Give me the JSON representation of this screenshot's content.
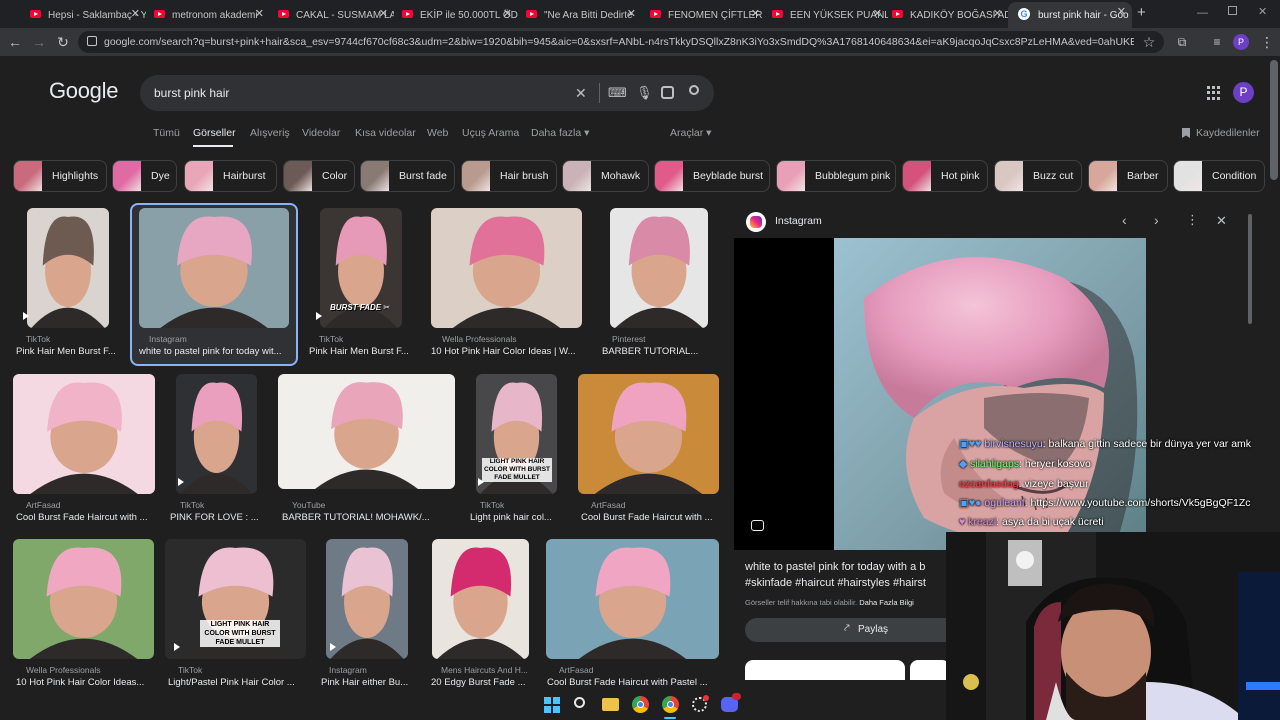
{
  "tabs": [
    {
      "label": "Hepsi - Saklambaç - Y"
    },
    {
      "label": "metronom akademi"
    },
    {
      "label": "CAKAL - SUSMAM LA"
    },
    {
      "label": "EKİP ile 50.000TL ÖD"
    },
    {
      "label": "\"Ne Ara Bitti Dedirte"
    },
    {
      "label": "FENOMEN ÇİFTLER S"
    },
    {
      "label": "EEN YÜKSEK PUANLI"
    },
    {
      "label": "KADIKÖY BOĞASI AD"
    },
    {
      "label": "burst pink hair - Goo"
    }
  ],
  "new_tab": "+",
  "address": {
    "url": "google.com/search?q=burst+pink+hair&sca_esv=9744cf670cf68c3&udm=2&biw=1920&bih=945&aic=0&sxsrf=ANbL-n4rsTkkyDSQllxZ8nK3iYo3xSmdDQ%3A1768140648634&ei=aK9jacqoJqCsxc8PzLeHMA&ved=0ahUKEwjK_Jia1YOSAxUgVvEDHc...",
    "avatar": "P"
  },
  "google": {
    "logo": "Google",
    "query": "burst pink hair",
    "avatar": "P"
  },
  "filters": [
    {
      "label": "Tümü"
    },
    {
      "label": "Görseller"
    },
    {
      "label": "Alışveriş"
    },
    {
      "label": "Videolar"
    },
    {
      "label": "Kısa videolar"
    },
    {
      "label": "Web"
    },
    {
      "label": "Uçuş Arama"
    },
    {
      "label": "Daha fazla ▾"
    }
  ],
  "tools": "Araçlar ▾",
  "saved": "Kaydedilenler",
  "chips": [
    {
      "label": "Highlights",
      "color": "#c96b7d"
    },
    {
      "label": "Dye",
      "color": "#e06aa4"
    },
    {
      "label": "Hairburst",
      "color": "#e9a6b8"
    },
    {
      "label": "Color",
      "color": "#6b5a56"
    },
    {
      "label": "Burst fade",
      "color": "#8a7a74"
    },
    {
      "label": "Hair brush",
      "color": "#b89a8e"
    },
    {
      "label": "Mohawk",
      "color": "#c9b3b8"
    },
    {
      "label": "Beyblade burst",
      "color": "#e05a8a"
    },
    {
      "label": "Bubblegum pink",
      "color": "#e8a0b8"
    },
    {
      "label": "Hot pink",
      "color": "#d4527c"
    },
    {
      "label": "Buzz cut",
      "color": "#d9c7c2"
    },
    {
      "label": "Barber",
      "color": "#d6a79a"
    },
    {
      "label": "Condition",
      "color": "#e2e2e2"
    }
  ],
  "results": [
    {
      "source": "TikTok",
      "title": "Pink Hair Men Burst F...",
      "bg": "#d9d4d0",
      "hair": "#6d5a50"
    },
    {
      "source": "Instagram",
      "title": "white to pastel pink for today wit...",
      "bg": "#8aa0a8",
      "hair": "#e7a7c2"
    },
    {
      "source": "TikTok",
      "title": "Pink Hair Men Burst F...",
      "bg": "#3b3533",
      "hair": "#e79ab8"
    },
    {
      "source": "Wella Professionals",
      "title": "10 Hot Pink Hair Color Ideas | W...",
      "bg": "#dccfc6",
      "hair": "#e2719a"
    },
    {
      "source": "Pinterest",
      "title": "BARBER TUTORIAL...",
      "bg": "#e6e6e6",
      "hair": "#d98aa6"
    },
    {
      "source": "ArtFasad",
      "title": "Cool Burst Fade Haircut with ...",
      "bg": "#f4d9e3",
      "hair": "#f0b3c8"
    },
    {
      "source": "TikTok",
      "title": "PINK FOR LOVE : ...",
      "bg": "#2f3033",
      "hair": "#e99fbd"
    },
    {
      "source": "YouTube",
      "title": "BARBER TUTORIAL! MOHAWK/...",
      "bg": "#f1efec",
      "hair": "#e9a5b9"
    },
    {
      "source": "TikTok",
      "title": "Light pink hair col...",
      "bg": "#48484a",
      "hair": "#e8b6c9"
    },
    {
      "source": "ArtFasad",
      "title": "Cool Burst Fade Haircut with ...",
      "bg": "#c98a3a",
      "hair": "#f0a3c0"
    },
    {
      "source": "Wella Professionals",
      "title": "10 Hot Pink Hair Color Ideas...",
      "bg": "#7fa86a",
      "hair": "#f0a8c2"
    },
    {
      "source": "TikTok",
      "title": "Light/Pastel Pink Hair Color ...",
      "bg": "#2b2b2b",
      "hair": "#eebfd0"
    },
    {
      "source": "Instagram",
      "title": "Pink Hair either Bu...",
      "bg": "#6e7b86",
      "hair": "#e9c3d3"
    },
    {
      "source": "Mens Haircuts And H...",
      "title": "20 Edgy Burst Fade ...",
      "bg": "#e9e4de",
      "hair": "#d42a6e"
    },
    {
      "source": "ArtFasad",
      "title": "Cool Burst Fade Haircut with Pastel ...",
      "bg": "#7aa3b5",
      "hair": "#f0a6c3"
    }
  ],
  "overlays": {
    "burst_fade": "BURST FADE ✂",
    "light_pink": "LIGHT PINK HAIR COLOR WITH BURST FADE MULLET",
    "light_pastel": "LIGHT PINK HAIR COLOR WITH BURST FADE MULLET"
  },
  "panel": {
    "source": "Instagram",
    "caption": "white to pastel pink for today with a b",
    "hashtags": "#skinfade #haircut #hairstyles #hairst",
    "copyright": "Görseller telif hakkına tabi olabilir.",
    "more_info": "Daha Fazla Bilgi",
    "share": "Paylaş"
  },
  "chat": [
    {
      "user": "birvisnesuyu",
      "text": ": balkana gittin sadece bir dünya yer var amk",
      "color": "#b7b3ff"
    },
    {
      "user": "silahligaps",
      "text": ": heryer kosovo",
      "color": "#6cff6c"
    },
    {
      "user": "ozcanfasdag",
      "text": ": vizeye başvur",
      "color": "#ff3b3b"
    },
    {
      "user": "oguleanf",
      "text": ": https://www.youtube.com/shorts/Vk5gBgQF1Zc",
      "color": "#c9a0ff"
    },
    {
      "user": "kreazi",
      "text": ": asya da bi uçak ücreti",
      "color": "#d48ad4"
    }
  ],
  "taskbar": [
    "windows-icon",
    "search-icon",
    "files-icon",
    "chrome-icon",
    "chrome-icon-2",
    "settings-icon",
    "discord-icon"
  ]
}
